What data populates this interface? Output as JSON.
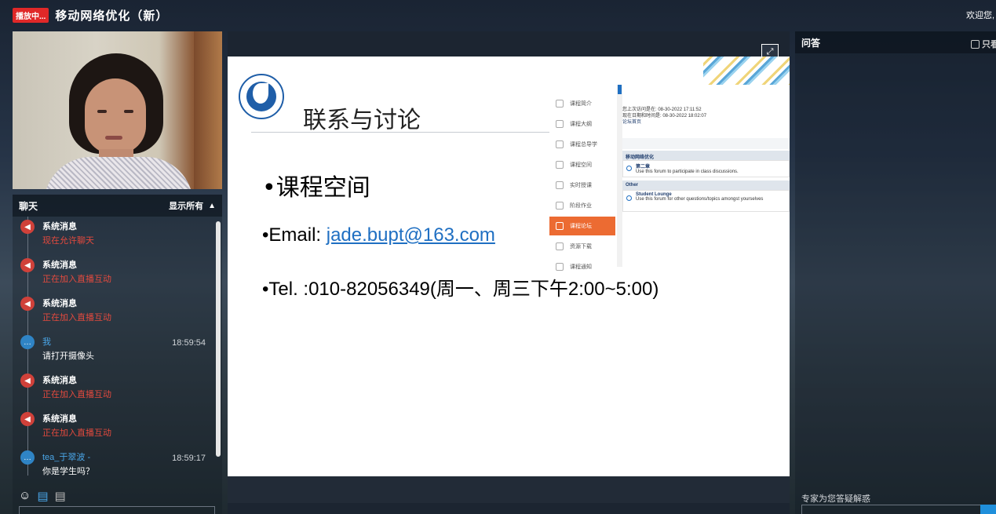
{
  "topbar": {
    "live_badge": "播放中...",
    "title": "移动网络优化（新）",
    "welcome": "欢迎您,"
  },
  "chat": {
    "header_title": "聊天",
    "show_all_label": "显示所有",
    "messages": [
      {
        "sender": "系统消息",
        "time": "",
        "text": "现在允许聊天",
        "type": "system"
      },
      {
        "sender": "系统消息",
        "time": "",
        "text": "正在加入直播互动",
        "type": "system"
      },
      {
        "sender": "系统消息",
        "time": "",
        "text": "正在加入直播互动",
        "type": "system"
      },
      {
        "sender": "我",
        "time": "18:59:54",
        "text": "请打开摄像头",
        "type": "user"
      },
      {
        "sender": "系统消息",
        "time": "",
        "text": "正在加入直播互动",
        "type": "system"
      },
      {
        "sender": "系统消息",
        "time": "",
        "text": "正在加入直播互动",
        "type": "system"
      },
      {
        "sender": "tea_于翠波 -",
        "time": "18:59:17",
        "text": "你是学生吗？",
        "type": "user"
      }
    ],
    "tools": [
      "smile-icon",
      "chat-settings-icon",
      "chat-list-icon"
    ]
  },
  "slide": {
    "title": "联系与讨论",
    "bullet1": "•课程空间",
    "bullet2_prefix": "•Email: ",
    "bullet2_link": "jade.bupt@163.com",
    "bullet3": "•Tel. :010-82056349(周一、周三下午2:00~5:00)",
    "inset": {
      "nav": [
        "课程简介",
        "课程大纲",
        "课程总导学",
        "课程空间",
        "实时授课",
        "阶段作业",
        "课程论坛",
        "资源下载",
        "课程通知"
      ],
      "active_index": 6,
      "info": [
        "您上次访问是在: 08-30-2022 17:11:52",
        "现在日期和时间是: 08-30-2022 18:02:07",
        "论坛首页"
      ],
      "section1": "移动网络优化",
      "forum1_name": "第二章",
      "forum1_desc": "Use this forum to participate in class discussions.",
      "section2": "Other",
      "forum2_name": "Student Lounge",
      "forum2_desc": "Use this forum for other questions/topics amongst yourselves"
    }
  },
  "qa": {
    "header_title": "问答",
    "only_label": "只看",
    "footer_text": "专家为您答疑解惑"
  },
  "colors": {
    "live_red": "#e02828",
    "system_red": "#e44a3e",
    "user_blue": "#4aa6e8",
    "nav_active": "#ec6b32",
    "link_blue": "#1f6fc2"
  }
}
